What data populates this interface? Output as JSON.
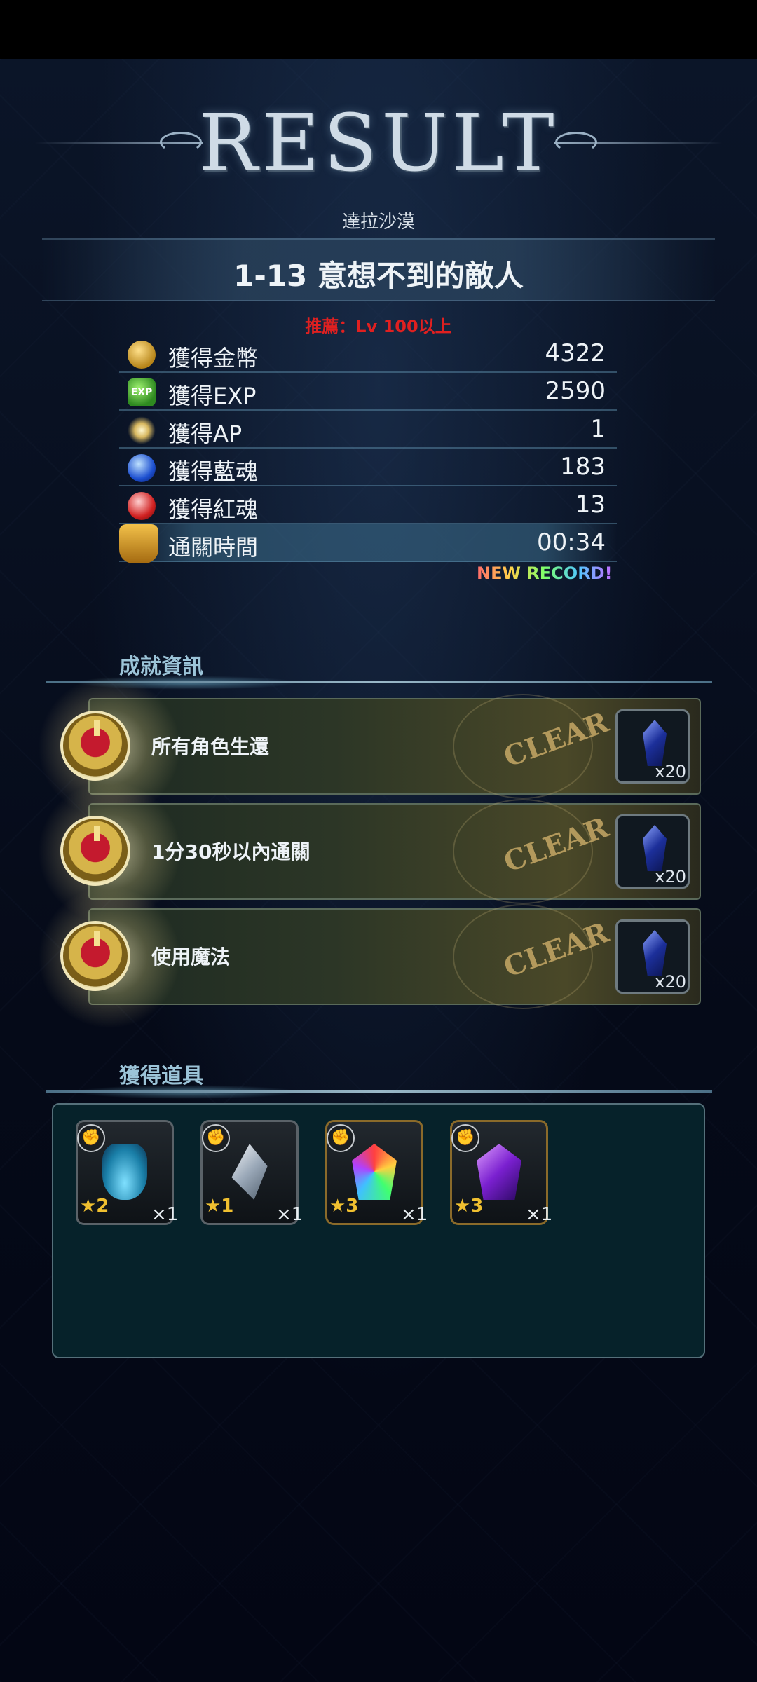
{
  "title": "RESULT",
  "area": "達拉沙漠",
  "stage": "1-13 意想不到的敵人",
  "recommend": "推薦：Lv 100以上",
  "rewards": [
    {
      "label": "獲得金幣",
      "value": "4322",
      "icon": "gold-coin-icon"
    },
    {
      "label": "獲得EXP",
      "value": "2590",
      "icon": "exp-icon"
    },
    {
      "label": "獲得AP",
      "value": "1",
      "icon": "ap-sparkle-icon"
    },
    {
      "label": "獲得藍魂",
      "value": "183",
      "icon": "blue-soul-icon"
    },
    {
      "label": "獲得紅魂",
      "value": "13",
      "icon": "red-soul-icon"
    },
    {
      "label": "通關時間",
      "value": "00:34",
      "icon": "trophy-icon"
    }
  ],
  "exp_icon_text": "EXP",
  "new_record": "NEW RECORD!",
  "achievements_title": "成就資訊",
  "achievements": [
    {
      "label": "所有角色生還",
      "status": "CLEAR",
      "reward_qty": "x20",
      "reward_icon": "blue-crystal-icon"
    },
    {
      "label": "1分30秒以內通關",
      "status": "CLEAR",
      "reward_qty": "x20",
      "reward_icon": "blue-crystal-icon"
    },
    {
      "label": "使用魔法",
      "status": "CLEAR",
      "reward_qty": "x20",
      "reward_icon": "blue-crystal-icon"
    }
  ],
  "items_title": "獲得道具",
  "items": [
    {
      "stars": "★2",
      "count": "×1",
      "icon": "potion-bottle-icon"
    },
    {
      "stars": "★1",
      "count": "×1",
      "icon": "silver-shard-icon"
    },
    {
      "stars": "★3",
      "count": "×1",
      "icon": "rainbow-crystal-icon"
    },
    {
      "stars": "★3",
      "count": "×1",
      "icon": "purple-crystal-icon"
    }
  ],
  "badge_icon": "strength-icon"
}
